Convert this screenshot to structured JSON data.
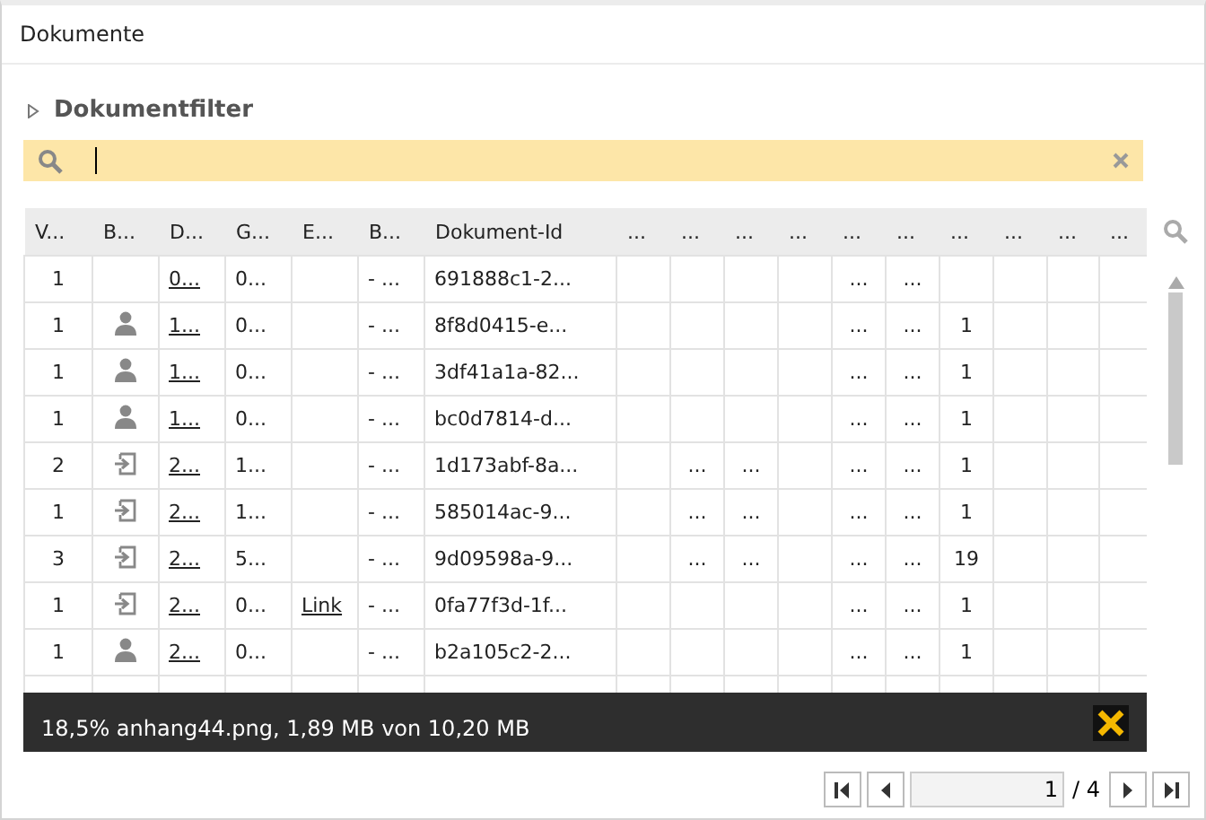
{
  "panel": {
    "title": "Dokumente"
  },
  "filter": {
    "label": "Dokumentfilter",
    "expanded": false
  },
  "table": {
    "columns": [
      "V...",
      "B...",
      "D...",
      "G...",
      "E...",
      "B...",
      "Dokument-Id",
      "...",
      "...",
      "...",
      "...",
      "...",
      "...",
      "...",
      "...",
      "...",
      "..."
    ],
    "rows": [
      {
        "v": "1",
        "d": "0...",
        "g": "0...",
        "b": "- ...",
        "id": "691888c1-2...",
        "cells": {
          "column_12": "...",
          "column_13": "..."
        }
      },
      {
        "v": "1",
        "kind": "person",
        "d": "1...",
        "g": "0...",
        "b": "- ...",
        "id": "8f8d0415-e...",
        "cells": {
          "column_12": "...",
          "column_13": "...",
          "column_14": "1"
        }
      },
      {
        "v": "1",
        "kind": "person",
        "d": "1...",
        "g": "0...",
        "b": "- ...",
        "id": "3df41a1a-82...",
        "cells": {
          "column_12": "...",
          "column_13": "...",
          "column_14": "1"
        }
      },
      {
        "v": "1",
        "kind": "person",
        "d": "1...",
        "g": "0...",
        "b": "- ...",
        "id": "bc0d7814-d...",
        "cells": {
          "column_12": "...",
          "column_13": "...",
          "column_14": "1"
        }
      },
      {
        "v": "2",
        "kind": "import",
        "d": "2...",
        "g": "1...",
        "b": "- ...",
        "id": "1d173abf-8a...",
        "cells": {
          "column_9": "...",
          "column_10": "...",
          "column_12": "...",
          "column_13": "...",
          "column_14": "1"
        }
      },
      {
        "v": "1",
        "kind": "import",
        "d": "2...",
        "g": "1...",
        "b": "- ...",
        "id": "585014ac-9...",
        "cells": {
          "column_9": "...",
          "column_10": "...",
          "column_12": "...",
          "column_13": "...",
          "column_14": "1"
        }
      },
      {
        "v": "3",
        "kind": "import",
        "d": "2...",
        "g": "5...",
        "b": "- ...",
        "id": "9d09598a-9...",
        "cells": {
          "column_9": "...",
          "column_10": "...",
          "column_12": "...",
          "column_13": "...",
          "column_14": "19"
        }
      },
      {
        "v": "1",
        "kind": "import",
        "d": "2...",
        "g": "0...",
        "e": "Link",
        "b": "- ...",
        "id": "0fa77f3d-1f...",
        "cells": {
          "column_12": "...",
          "column_13": "...",
          "column_14": "1"
        }
      },
      {
        "v": "1",
        "kind": "person",
        "d": "2...",
        "g": "0...",
        "b": "- ...",
        "id": "b2a105c2-2...",
        "cells": {
          "column_12": "...",
          "column_13": "...",
          "column_14": "1"
        }
      }
    ]
  },
  "upload": {
    "message": "18,5% anhang44.png, 1,89 MB von 10,20 MB"
  },
  "pager": {
    "page": "1",
    "total": "/ 4"
  }
}
